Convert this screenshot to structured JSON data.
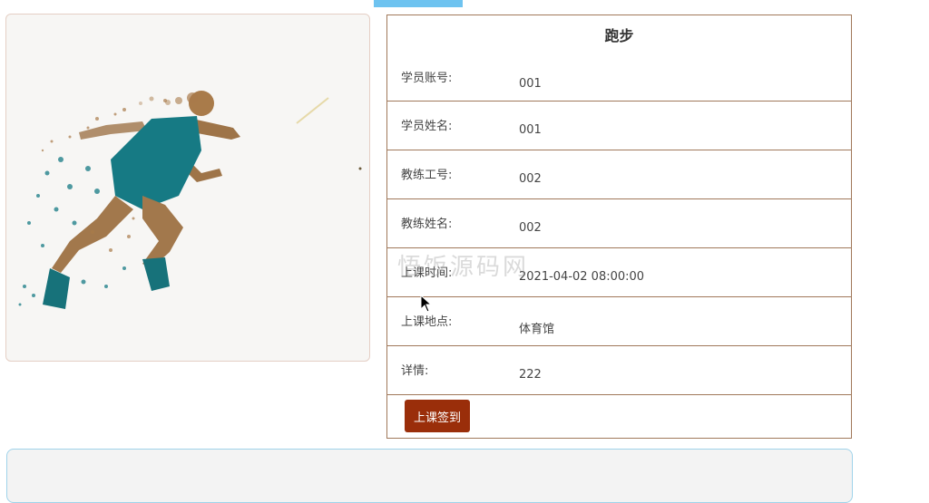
{
  "course": {
    "title": "跑步",
    "rows": [
      {
        "label": "学员账号:",
        "value": "001"
      },
      {
        "label": "学员姓名:",
        "value": "001"
      },
      {
        "label": "教练工号:",
        "value": "002"
      },
      {
        "label": "教练姓名:",
        "value": "002"
      },
      {
        "label": "上课时间:",
        "value": "2021-04-02 08:00:00"
      },
      {
        "label": "上课地点:",
        "value": "体育馆"
      },
      {
        "label": "详情:",
        "value": "222"
      }
    ],
    "checkin_label": "上课签到"
  },
  "watermark": "悟饭源码网",
  "colors": {
    "accent": "#9a2e0a",
    "border": "#a0785a",
    "tab": "#6ec3f0"
  }
}
